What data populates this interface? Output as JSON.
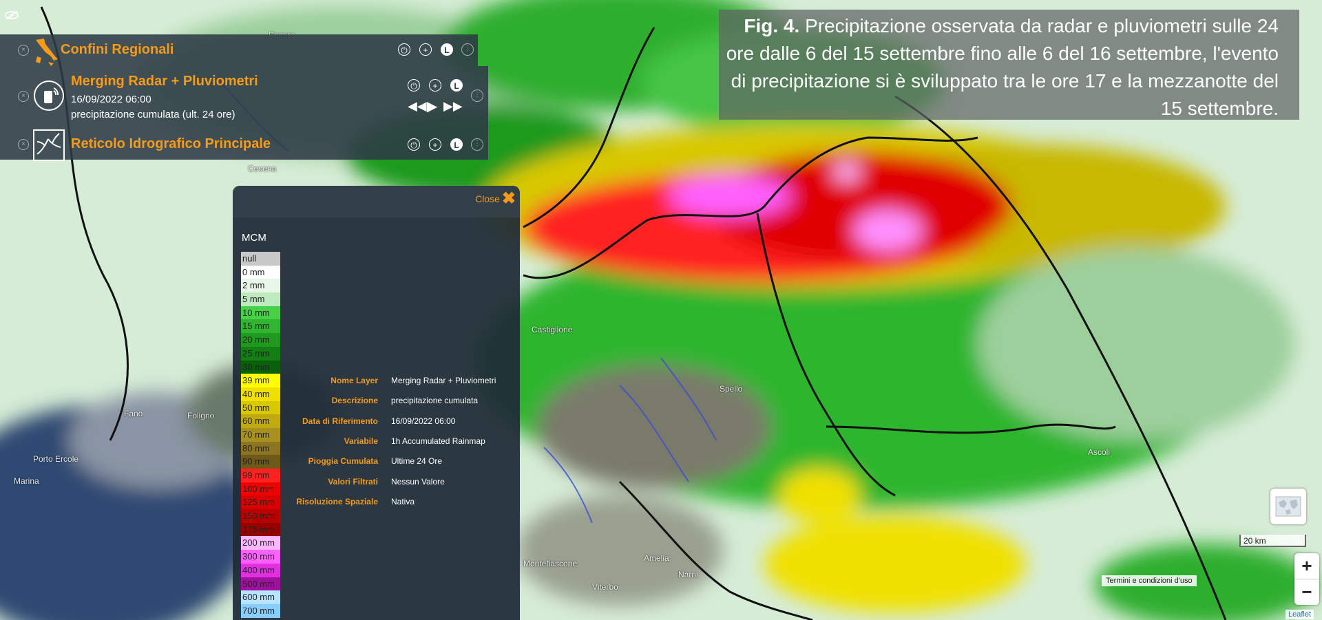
{
  "layers": [
    {
      "title": "Confini Regionali",
      "icon": "italy-map-icon"
    },
    {
      "title": "Merging Radar + Pluviometri",
      "date": "16/09/2022 06:00",
      "subtitle": "precipitazione cumulata (ult. 24 ore)",
      "icon": "radar-icon"
    },
    {
      "title": "Reticolo Idrografico Principale",
      "icon": "river-network-icon"
    }
  ],
  "legend": {
    "close_label": "Close",
    "title": "MCM",
    "classes": [
      {
        "label": "null",
        "color": "#c8c8c8",
        "text_color": "#222"
      },
      {
        "label": "0 mm",
        "color": "#ffffff",
        "text_color": "#222"
      },
      {
        "label": "2 mm",
        "color": "#e8f6e8",
        "text_color": "#222"
      },
      {
        "label": "5 mm",
        "color": "#bfeabf",
        "text_color": "#222"
      },
      {
        "label": "10 mm",
        "color": "#48d048",
        "text_color": "#222"
      },
      {
        "label": "15 mm",
        "color": "#2fb52f",
        "text_color": "#222"
      },
      {
        "label": "20 mm",
        "color": "#1f9a1f",
        "text_color": "#222"
      },
      {
        "label": "25 mm",
        "color": "#137e13",
        "text_color": "#222"
      },
      {
        "label": "30 mm",
        "color": "#0a600a",
        "text_color": "#222"
      },
      {
        "label": "39 mm",
        "color": "#ffff00",
        "text_color": "#222"
      },
      {
        "label": "40 mm",
        "color": "#f0e000",
        "text_color": "#222"
      },
      {
        "label": "50 mm",
        "color": "#d8c800",
        "text_color": "#222"
      },
      {
        "label": "60 mm",
        "color": "#c0aa10",
        "text_color": "#222"
      },
      {
        "label": "70 mm",
        "color": "#a89020",
        "text_color": "#222"
      },
      {
        "label": "80 mm",
        "color": "#8c7420",
        "text_color": "#222"
      },
      {
        "label": "90 mm",
        "color": "#6e5a18",
        "text_color": "#222"
      },
      {
        "label": "99 mm",
        "color": "#ff2020",
        "text_color": "#222"
      },
      {
        "label": "100 mm",
        "color": "#f00000",
        "text_color": "#222"
      },
      {
        "label": "125 mm",
        "color": "#d80000",
        "text_color": "#222"
      },
      {
        "label": "150 mm",
        "color": "#b80000",
        "text_color": "#222"
      },
      {
        "label": "175 mm",
        "color": "#980000",
        "text_color": "#222"
      },
      {
        "label": "200 mm",
        "color": "#ffb8ff",
        "text_color": "#222"
      },
      {
        "label": "300 mm",
        "color": "#ff60ff",
        "text_color": "#222"
      },
      {
        "label": "400 mm",
        "color": "#e030e0",
        "text_color": "#222"
      },
      {
        "label": "500 mm",
        "color": "#a010a0",
        "text_color": "#222"
      },
      {
        "label": "600 mm",
        "color": "#b8e4ff",
        "text_color": "#222"
      },
      {
        "label": "700 mm",
        "color": "#88cfff",
        "text_color": "#222"
      }
    ],
    "info": [
      {
        "label": "Nome Layer",
        "value": "Merging Radar + Pluviometri"
      },
      {
        "label": "Descrizione",
        "value": "precipitazione cumulata"
      },
      {
        "label": "Data di Riferimento",
        "value": "16/09/2022 06:00"
      },
      {
        "label": "Variabile",
        "value": "1h Accumulated Rainmap"
      },
      {
        "label": "Pioggia Cumulata",
        "value": "Ultime 24 Ore"
      },
      {
        "label": "Valori Filtrati",
        "value": "Nessun Valore"
      },
      {
        "label": "Risoluzione Spaziale",
        "value": "Nativa"
      }
    ]
  },
  "caption": {
    "fig": "Fig. 4.",
    "text": " Precipitazione osservata da radar e pluviometri sulle 24 ore dalle 6 del 15 settembre fino alle 6 del 16 settembre, l'evento di precipitazione si è sviluppato tra le ore 17 e la mezzanotte del 15 settembre."
  },
  "map": {
    "places": [
      "Fano",
      "Pesaro",
      "Cesena",
      "Spello",
      "Foligno",
      "Montefiascone",
      "Castiglione",
      "Porto Ercole",
      "Marina",
      "Ascoli",
      "Narni",
      "Amelia",
      "Viterbo"
    ],
    "scale_label": "20 km",
    "terms_label": "Termini e condizioni d'uso",
    "attribution": "Leaflet",
    "zoom_in": "+",
    "zoom_out": "−"
  }
}
